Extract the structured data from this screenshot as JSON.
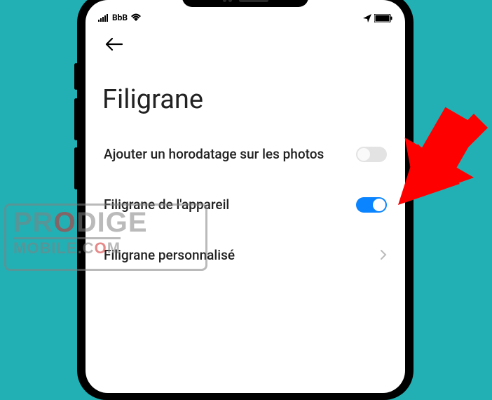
{
  "statusbar": {
    "carrier": "BbB"
  },
  "page": {
    "title": "Filigrane"
  },
  "settings": {
    "timestamp": {
      "label": "Ajouter un horodatage sur les photos",
      "on": false
    },
    "device": {
      "label": "Filigrane de l'appareil",
      "on": true
    },
    "custom": {
      "label": "Filigrane personnalisé"
    }
  },
  "watermark": {
    "line1_a": "PR",
    "line1_b": "O",
    "line1_c": "DIGE",
    "line2_a": "MOBILE",
    "line2_b": ".C",
    "line2_c": "O",
    "line2_d": "M"
  }
}
